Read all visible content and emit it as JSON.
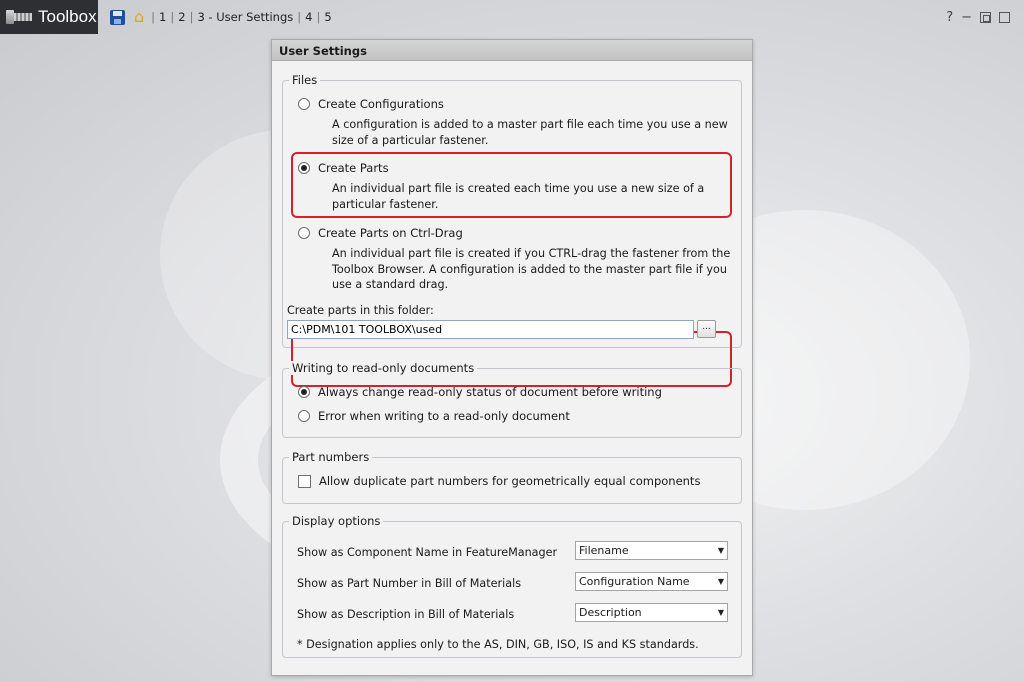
{
  "app": {
    "title": "Toolbox"
  },
  "breadcrumb": {
    "items": [
      {
        "label": "1"
      },
      {
        "label": "2"
      },
      {
        "label": "3 - User Settings"
      },
      {
        "label": "4"
      },
      {
        "label": "5"
      }
    ]
  },
  "window_controls": {
    "help": "?",
    "minimize": "−"
  },
  "dialog": {
    "title": "User Settings",
    "files": {
      "legend": "Files",
      "options": [
        {
          "label": "Create Configurations",
          "description": "A configuration is added to a master part file each time you use a new size of a particular fastener.",
          "checked": false
        },
        {
          "label": "Create Parts",
          "description": "An individual part file is created each time you use a new size of a particular fastener.",
          "checked": true
        },
        {
          "label": "Create Parts on Ctrl-Drag",
          "description": "An individual part file is created if you CTRL-drag the fastener from the Toolbox Browser. A configuration is added to the master part file if you use a standard drag.",
          "checked": false
        }
      ],
      "folder_label": "Create parts in this folder:",
      "folder_value": "C:\\PDM\\101 TOOLBOX\\used",
      "browse_label": "..."
    },
    "readonly": {
      "legend": "Writing to read-only documents",
      "options": [
        {
          "label": "Always change read-only status of document before writing",
          "checked": true
        },
        {
          "label": "Error when writing to a read-only document",
          "checked": false
        }
      ]
    },
    "part_numbers": {
      "legend": "Part numbers",
      "checkbox_label": "Allow duplicate part numbers for geometrically equal components",
      "checked": false
    },
    "display": {
      "legend": "Display options",
      "rows": [
        {
          "label": "Show as Component Name in FeatureManager",
          "value": "Filename"
        },
        {
          "label": "Show as Part Number in Bill of Materials",
          "value": "Configuration Name"
        },
        {
          "label": "Show as Description in Bill of Materials",
          "value": "Description"
        }
      ],
      "note": "* Designation applies only to the AS, DIN, GB, ISO, IS and KS standards."
    }
  },
  "colors": {
    "highlight": "#d6202b",
    "brand_bg": "#2e2f33",
    "dialog_bg": "#f2f2f2"
  }
}
